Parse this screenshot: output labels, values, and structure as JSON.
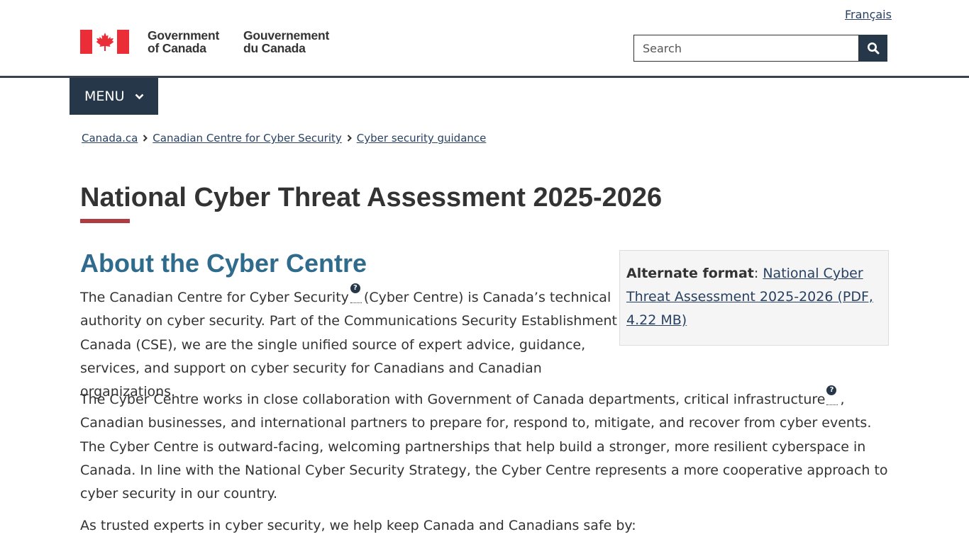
{
  "header": {
    "language_link": "Français",
    "signature_en_line1": "Government",
    "signature_en_line2": "of Canada",
    "signature_fr_line1": "Gouvernement",
    "signature_fr_line2": "du Canada",
    "search_placeholder": "Search",
    "search_icon": "search-icon",
    "menu_label": "MENU",
    "menu_icon": "chevron-down-icon"
  },
  "breadcrumb": {
    "items": [
      "Canada.ca",
      "Canadian Centre for Cyber Security",
      "Cyber security guidance"
    ]
  },
  "main": {
    "title": "National Cyber Threat Assessment 2025-2026",
    "section_heading": "About the Cyber Centre",
    "alternate_format": {
      "label": "Alternate format",
      "link_text": "National Cyber Threat Assessment 2025-2026 (PDF, 4.22 MB)"
    },
    "paragraph1_start": "The Canadian Centre for Cyber Security",
    "paragraph1_end": "(Cyber Centre) is Canada’s technical authority on cyber security. Part of the Communications Security Establishment Canada (CSE), we are the single unified source of expert advice, guidance, services, and support on cyber security for Canadians and Canadian organizations.",
    "paragraph2_start": "The Cyber Centre works in close collaboration with Government of Canada departments, critical infrastructure",
    "paragraph2_end": ", Canadian businesses, and international partners to prepare for, respond to, mitigate, and recover from cyber events. The Cyber Centre is outward-facing, welcoming partnerships that help build a stronger, more resilient cyberspace in Canada. In line with the National Cyber Security Strategy, the Cyber Centre represents a more cooperative approach to cyber security in our country.",
    "paragraph3": "As trusted experts in cyber security, we help keep Canada and Canadians safe by:",
    "help_icon_symbol": "?"
  },
  "colors": {
    "navy": "#26374a",
    "link": "#284162",
    "accent_red": "#af3c43",
    "heading_blue": "#2e6b8c",
    "flag_red": "#eb2d37"
  }
}
